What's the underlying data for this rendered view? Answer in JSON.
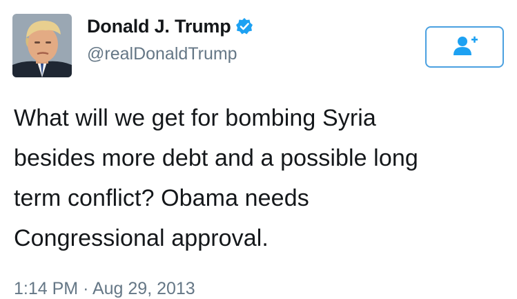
{
  "user": {
    "display_name": "Donald J. Trump",
    "handle": "@realDonaldTrump",
    "verified": true,
    "verified_icon": "verified-badge-icon"
  },
  "follow_button": {
    "icon": "add-user-icon",
    "color": "#1da1f2"
  },
  "tweet": {
    "text_lines": [
      "What will we get for bombing Syria",
      "besides more debt and a possible long",
      "term conflict? Obama needs",
      "Congressional approval."
    ],
    "time": "1:14 PM",
    "separator": "·",
    "date": "Aug 29, 2013"
  },
  "colors": {
    "accent": "#1da1f2",
    "text": "#14171a",
    "secondary_text": "#657786"
  }
}
